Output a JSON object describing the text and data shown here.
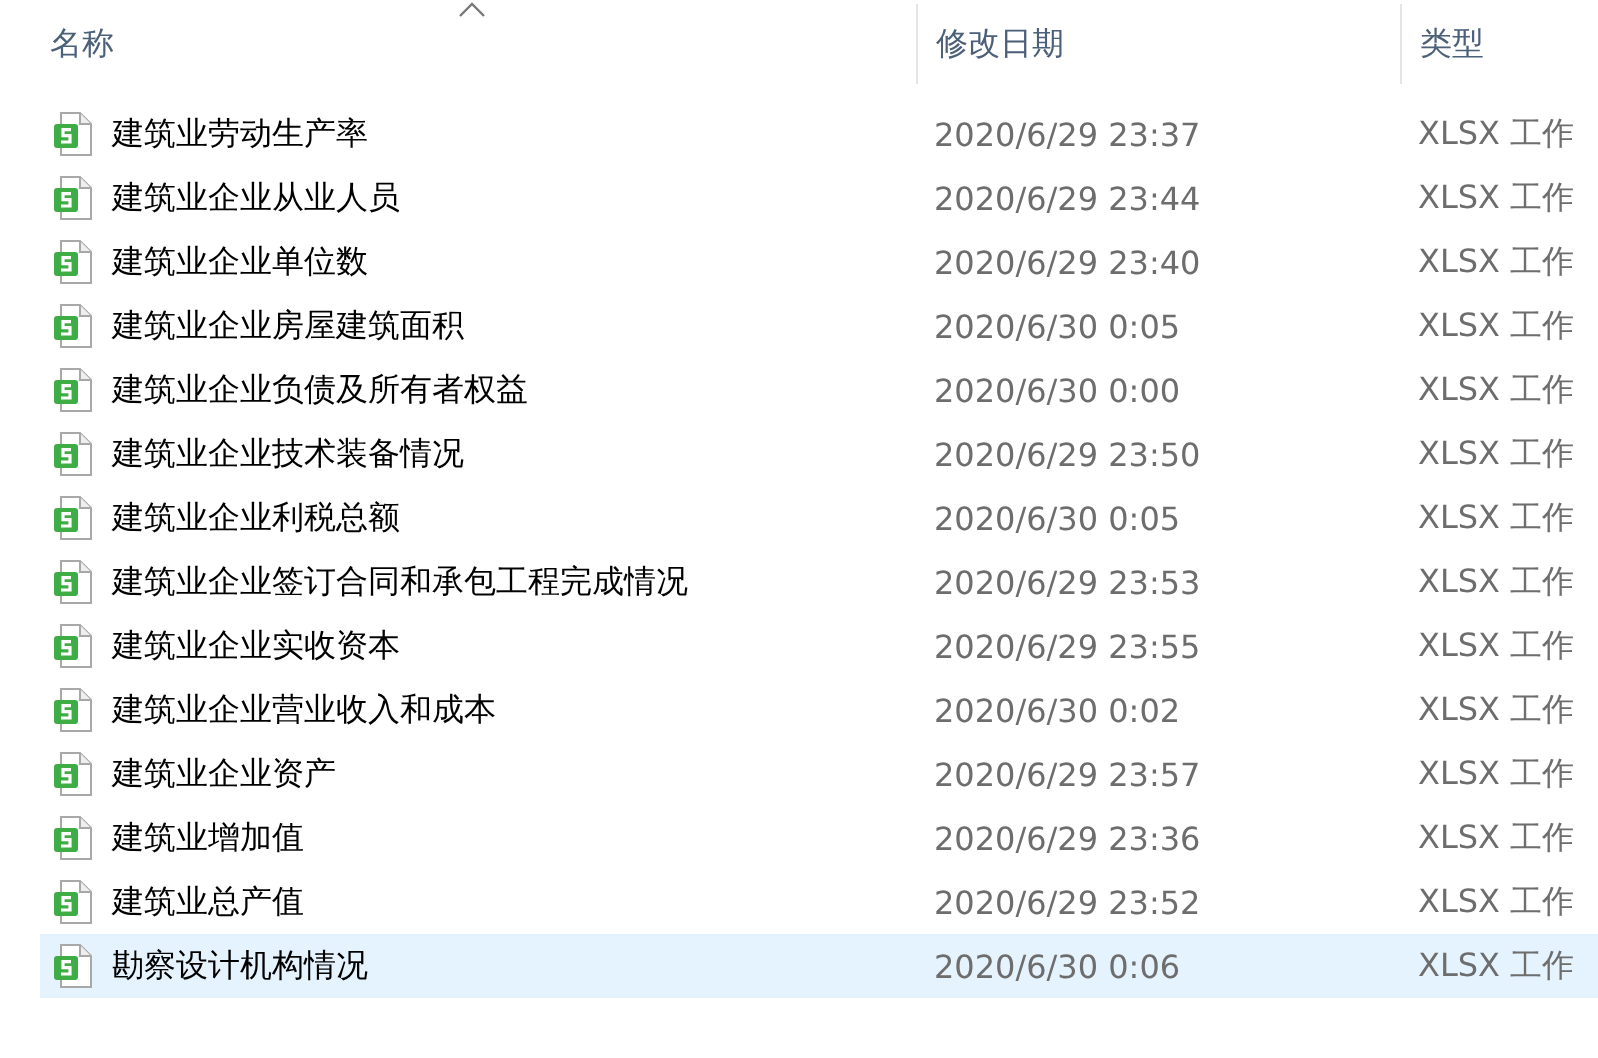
{
  "columns": [
    {
      "label": "名称",
      "sorted": true
    },
    {
      "label": "修改日期",
      "sorted": false
    },
    {
      "label": "类型",
      "sorted": false
    }
  ],
  "rows": [
    {
      "name": "建筑业劳动生产率",
      "modified": "2020/6/29 23:37",
      "type": "XLSX 工作",
      "selected": false
    },
    {
      "name": "建筑业企业从业人员",
      "modified": "2020/6/29 23:44",
      "type": "XLSX 工作",
      "selected": false
    },
    {
      "name": "建筑业企业单位数",
      "modified": "2020/6/29 23:40",
      "type": "XLSX 工作",
      "selected": false
    },
    {
      "name": "建筑业企业房屋建筑面积",
      "modified": "2020/6/30 0:05",
      "type": "XLSX 工作",
      "selected": false
    },
    {
      "name": "建筑业企业负债及所有者权益",
      "modified": "2020/6/30 0:00",
      "type": "XLSX 工作",
      "selected": false
    },
    {
      "name": "建筑业企业技术装备情况",
      "modified": "2020/6/29 23:50",
      "type": "XLSX 工作",
      "selected": false
    },
    {
      "name": "建筑业企业利税总额",
      "modified": "2020/6/30 0:05",
      "type": "XLSX 工作",
      "selected": false
    },
    {
      "name": "建筑业企业签订合同和承包工程完成情况",
      "modified": "2020/6/29 23:53",
      "type": "XLSX 工作",
      "selected": false
    },
    {
      "name": "建筑业企业实收资本",
      "modified": "2020/6/29 23:55",
      "type": "XLSX 工作",
      "selected": false
    },
    {
      "name": "建筑业企业营业收入和成本",
      "modified": "2020/6/30 0:02",
      "type": "XLSX 工作",
      "selected": false
    },
    {
      "name": "建筑业企业资产",
      "modified": "2020/6/29 23:57",
      "type": "XLSX 工作",
      "selected": false
    },
    {
      "name": "建筑业增加值",
      "modified": "2020/6/29 23:36",
      "type": "XLSX 工作",
      "selected": false
    },
    {
      "name": "建筑业总产值",
      "modified": "2020/6/29 23:52",
      "type": "XLSX 工作",
      "selected": false
    },
    {
      "name": "勘察设计机构情况",
      "modified": "2020/6/30 0:06",
      "type": "XLSX 工作",
      "selected": true
    }
  ]
}
